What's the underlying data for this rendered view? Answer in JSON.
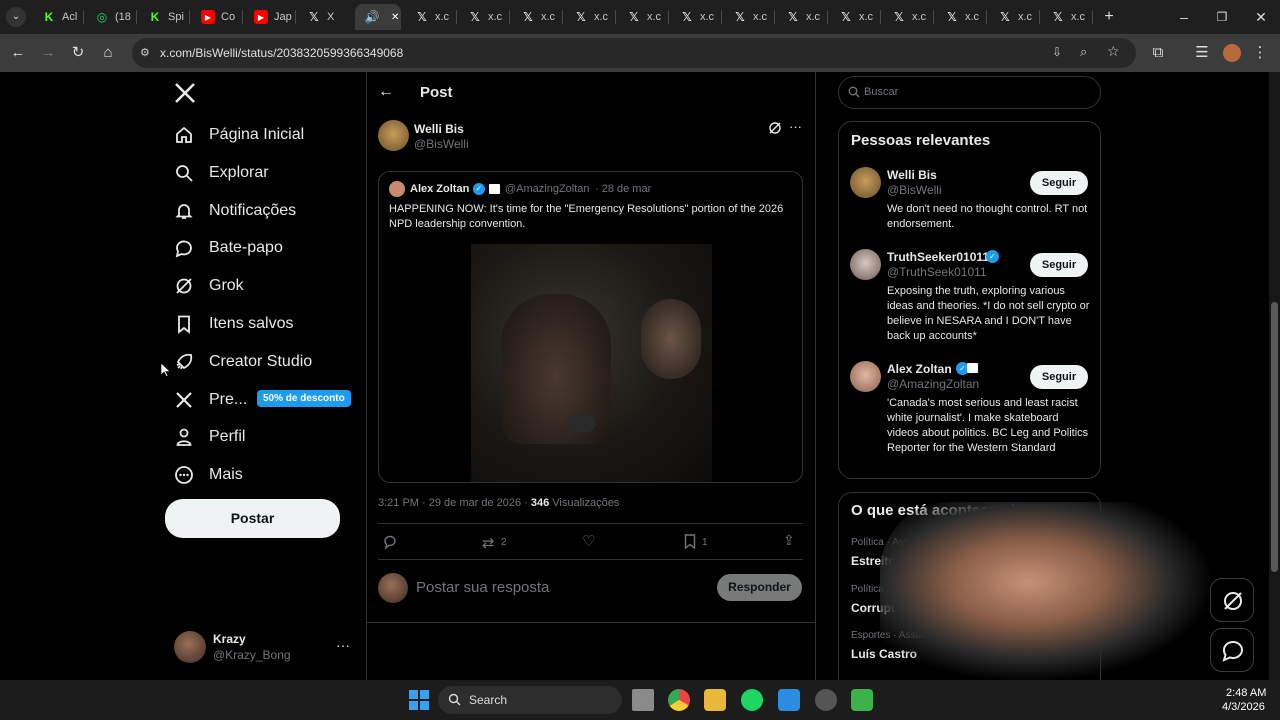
{
  "browser": {
    "tabs": [
      {
        "label": "Acl",
        "icon": "k-icon"
      },
      {
        "label": "(18",
        "icon": "whatsapp-icon"
      },
      {
        "label": "Spi",
        "icon": "k-icon"
      },
      {
        "label": "Co",
        "icon": "youtube-icon"
      },
      {
        "label": "Jap",
        "icon": "youtube-icon"
      },
      {
        "label": "X",
        "icon": "x-icon"
      },
      {
        "label": "",
        "icon": "speaker-icon"
      },
      {
        "label": "x.c",
        "icon": "x-icon"
      },
      {
        "label": "x.c",
        "icon": "x-icon"
      },
      {
        "label": "x.c",
        "icon": "x-icon"
      },
      {
        "label": "x.c",
        "icon": "x-icon"
      },
      {
        "label": "x.c",
        "icon": "x-icon"
      },
      {
        "label": "x.c",
        "icon": "x-icon"
      },
      {
        "label": "x.c",
        "icon": "x-icon"
      },
      {
        "label": "x.c",
        "icon": "x-icon"
      },
      {
        "label": "x.c",
        "icon": "x-icon"
      },
      {
        "label": "x.c",
        "icon": "x-icon"
      },
      {
        "label": "x.c",
        "icon": "x-icon"
      },
      {
        "label": "x.c",
        "icon": "x-icon"
      },
      {
        "label": "x.c",
        "icon": "x-icon"
      }
    ],
    "url": "x.com/BisWelli/status/2038320599366349068",
    "accent": "#1d9bf0"
  },
  "sidebar": {
    "items": [
      {
        "label": "Página Inicial",
        "icon": "home-icon"
      },
      {
        "label": "Explorar",
        "icon": "search-icon"
      },
      {
        "label": "Notificações",
        "icon": "bell-icon"
      },
      {
        "label": "Bate-papo",
        "icon": "chat-icon"
      },
      {
        "label": "Grok",
        "icon": "grok-icon"
      },
      {
        "label": "Itens salvos",
        "icon": "bookmark-icon"
      },
      {
        "label": "Creator Studio",
        "icon": "rocket-icon"
      },
      {
        "label": "Pre...",
        "icon": "x-icon"
      },
      {
        "label": "Perfil",
        "icon": "person-icon"
      },
      {
        "label": "Mais",
        "icon": "more-circle-icon"
      }
    ],
    "premium_badge": "50% de desconto",
    "post_button": "Postar",
    "account": {
      "name": "Krazy",
      "handle": "@Krazy_Bong"
    }
  },
  "post": {
    "header_title": "Post",
    "author": {
      "name": "Welli Bis",
      "handle": "@BisWelli"
    },
    "quoted": {
      "name": "Alex Zoltan",
      "handle": "@AmazingZoltan",
      "date": "· 28 de mar",
      "text": "HAPPENING NOW: It's time for the \"Emergency Resolutions\" portion of the 2026 NPD leadership convention."
    },
    "timestamp": "3:21 PM · 29 de mar de 2026 ·",
    "views_count": "346",
    "views_label": "Visualizações",
    "retweets": "2",
    "bookmarks": "1",
    "reply_placeholder": "Postar sua resposta",
    "reply_button": "Responder"
  },
  "right": {
    "search_placeholder": "Buscar",
    "relevant_title": "Pessoas relevantes",
    "people": [
      {
        "name": "Welli Bis",
        "handle": "@BisWelli",
        "bio": "We don't need no thought control. RT not endorsement.",
        "button": "Seguir"
      },
      {
        "name": "TruthSeeker01011",
        "handle": "@TruthSeek01011",
        "bio": "Exposing the truth, exploring various ideas and theories. *I do not sell crypto or believe in NESARA and I DON'T have back up accounts*",
        "button": "Seguir"
      },
      {
        "name": "Alex Zoltan",
        "handle": "@AmazingZoltan",
        "bio": "'Canada's most serious and least racist white journalist'. I make skateboard videos about politics. BC Leg and Politics Reporter for the Western Standard",
        "button": "Seguir"
      }
    ],
    "trending_title": "O que está acontecendo",
    "trends": [
      {
        "category": "Política · Assunto do Momento",
        "name": "Estreito de Ormuz"
      },
      {
        "category": "Política · Assunto do Momento",
        "name": "Corrupt"
      },
      {
        "category": "Esportes · Assunto do Momento",
        "name": "Luís Castro"
      }
    ]
  },
  "taskbar": {
    "search": "Search",
    "time": "2:48 AM",
    "date": "4/3/2026"
  }
}
